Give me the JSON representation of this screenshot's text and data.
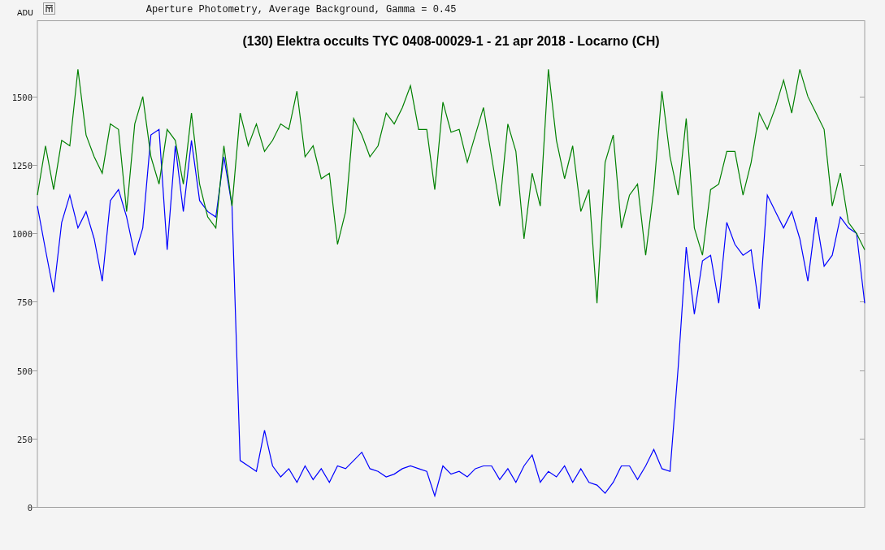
{
  "header": {
    "subtitle": "Aperture Photometry, Average Background, Gamma = 0.45"
  },
  "chart_data": {
    "type": "line",
    "title": "(130) Elektra occults TYC 0408-00029-1 - 21 apr 2018 - Locarno (CH)",
    "ylabel": "ADU",
    "ylim": [
      0,
      1779
    ],
    "yticks": [
      0,
      250,
      500,
      750,
      1000,
      1250,
      1500
    ],
    "categories": [
      null,
      null,
      null,
      null,
      null,
      null,
      null,
      null,
      null,
      null,
      null,
      null,
      null,
      null,
      null,
      null,
      null,
      null,
      null,
      null,
      null,
      null,
      null,
      null,
      null,
      null,
      null,
      null,
      null,
      null,
      null,
      null,
      null,
      null,
      null,
      null,
      null,
      null,
      null,
      null,
      null,
      null,
      null,
      null,
      null,
      null,
      null,
      null,
      null,
      null,
      null,
      null,
      null,
      null,
      null,
      null,
      null,
      null,
      null,
      null,
      null,
      null,
      null,
      null,
      null,
      null,
      null,
      null,
      null,
      null,
      null,
      null,
      null,
      null,
      null,
      null,
      null,
      null,
      null,
      null,
      null,
      null,
      null,
      null,
      null,
      null,
      null,
      null,
      null,
      null,
      null,
      null,
      null,
      null,
      null,
      null,
      null,
      null,
      null,
      null,
      null,
      null,
      null
    ],
    "series": [
      {
        "color": "#0000ff",
        "values": [
          1100,
          940,
          785,
          1040,
          1140,
          1020,
          1080,
          980,
          825,
          1120,
          1160,
          1060,
          920,
          1020,
          1360,
          1380,
          940,
          1320,
          1080,
          1340,
          1120,
          1080,
          1060,
          1280,
          1100,
          170,
          150,
          130,
          280,
          150,
          110,
          140,
          90,
          150,
          100,
          140,
          90,
          150,
          140,
          170,
          200,
          140,
          130,
          110,
          120,
          140,
          150,
          140,
          130,
          40,
          150,
          120,
          130,
          110,
          140,
          150,
          150,
          100,
          140,
          90,
          150,
          190,
          90,
          130,
          110,
          150,
          90,
          140,
          90,
          80,
          50,
          90,
          150,
          150,
          100,
          150,
          210,
          140,
          130,
          510,
          950,
          705,
          900,
          920,
          745,
          1040,
          960,
          920,
          940,
          725,
          1140,
          1080,
          1020,
          1080,
          980,
          825,
          1060,
          880,
          920,
          1060,
          1020,
          1000,
          745
        ]
      },
      {
        "color": "#008000",
        "values": [
          1140,
          1320,
          1160,
          1340,
          1320,
          1600,
          1360,
          1280,
          1220,
          1400,
          1380,
          1080,
          1400,
          1500,
          1280,
          1180,
          1380,
          1340,
          1180,
          1440,
          1180,
          1060,
          1020,
          1320,
          1100,
          1440,
          1320,
          1400,
          1300,
          1340,
          1400,
          1380,
          1520,
          1280,
          1320,
          1200,
          1220,
          960,
          1080,
          1420,
          1360,
          1280,
          1320,
          1440,
          1400,
          1460,
          1540,
          1380,
          1380,
          1160,
          1480,
          1370,
          1380,
          1260,
          1360,
          1460,
          1280,
          1100,
          1400,
          1300,
          980,
          1220,
          1100,
          1600,
          1340,
          1200,
          1320,
          1080,
          1160,
          745,
          1260,
          1360,
          1020,
          1140,
          1180,
          920,
          1160,
          1520,
          1280,
          1140,
          1420,
          1020,
          920,
          1160,
          1180,
          1300,
          1300,
          1140,
          1260,
          1440,
          1380,
          1460,
          1560,
          1440,
          1600,
          1500,
          1440,
          1380,
          1100,
          1220,
          1040,
          1000,
          940
        ]
      }
    ]
  }
}
